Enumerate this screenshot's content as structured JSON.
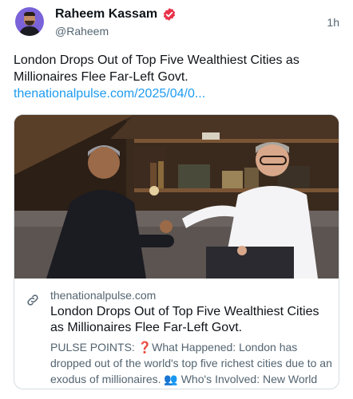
{
  "author": {
    "display_name": "Raheem Kassam",
    "handle": "@Raheem",
    "verified_icon": "verified-badge-icon",
    "avatar_icon": "avatar"
  },
  "post": {
    "timestamp": "1h",
    "text": "London Drops Out of Top Five Wealthiest Cities as Millionaires Flee Far-Left Govt.",
    "link": "thenationalpulse.com/2025/04/0..."
  },
  "card": {
    "domain": "thenationalpulse.com",
    "title": "London Drops Out of Top Five Wealthiest Cities as Millionaires Flee Far-Left Govt.",
    "description": "PULSE POINTS: ❓What Happened: London has dropped out of the world's top five richest cities due to an exodus of millionaires. 👥 Who's Involved: New World",
    "link_icon": "link-icon"
  },
  "colors": {
    "accent": "#1d9bf0",
    "verified": "#e8334a",
    "text_secondary": "#536471"
  }
}
